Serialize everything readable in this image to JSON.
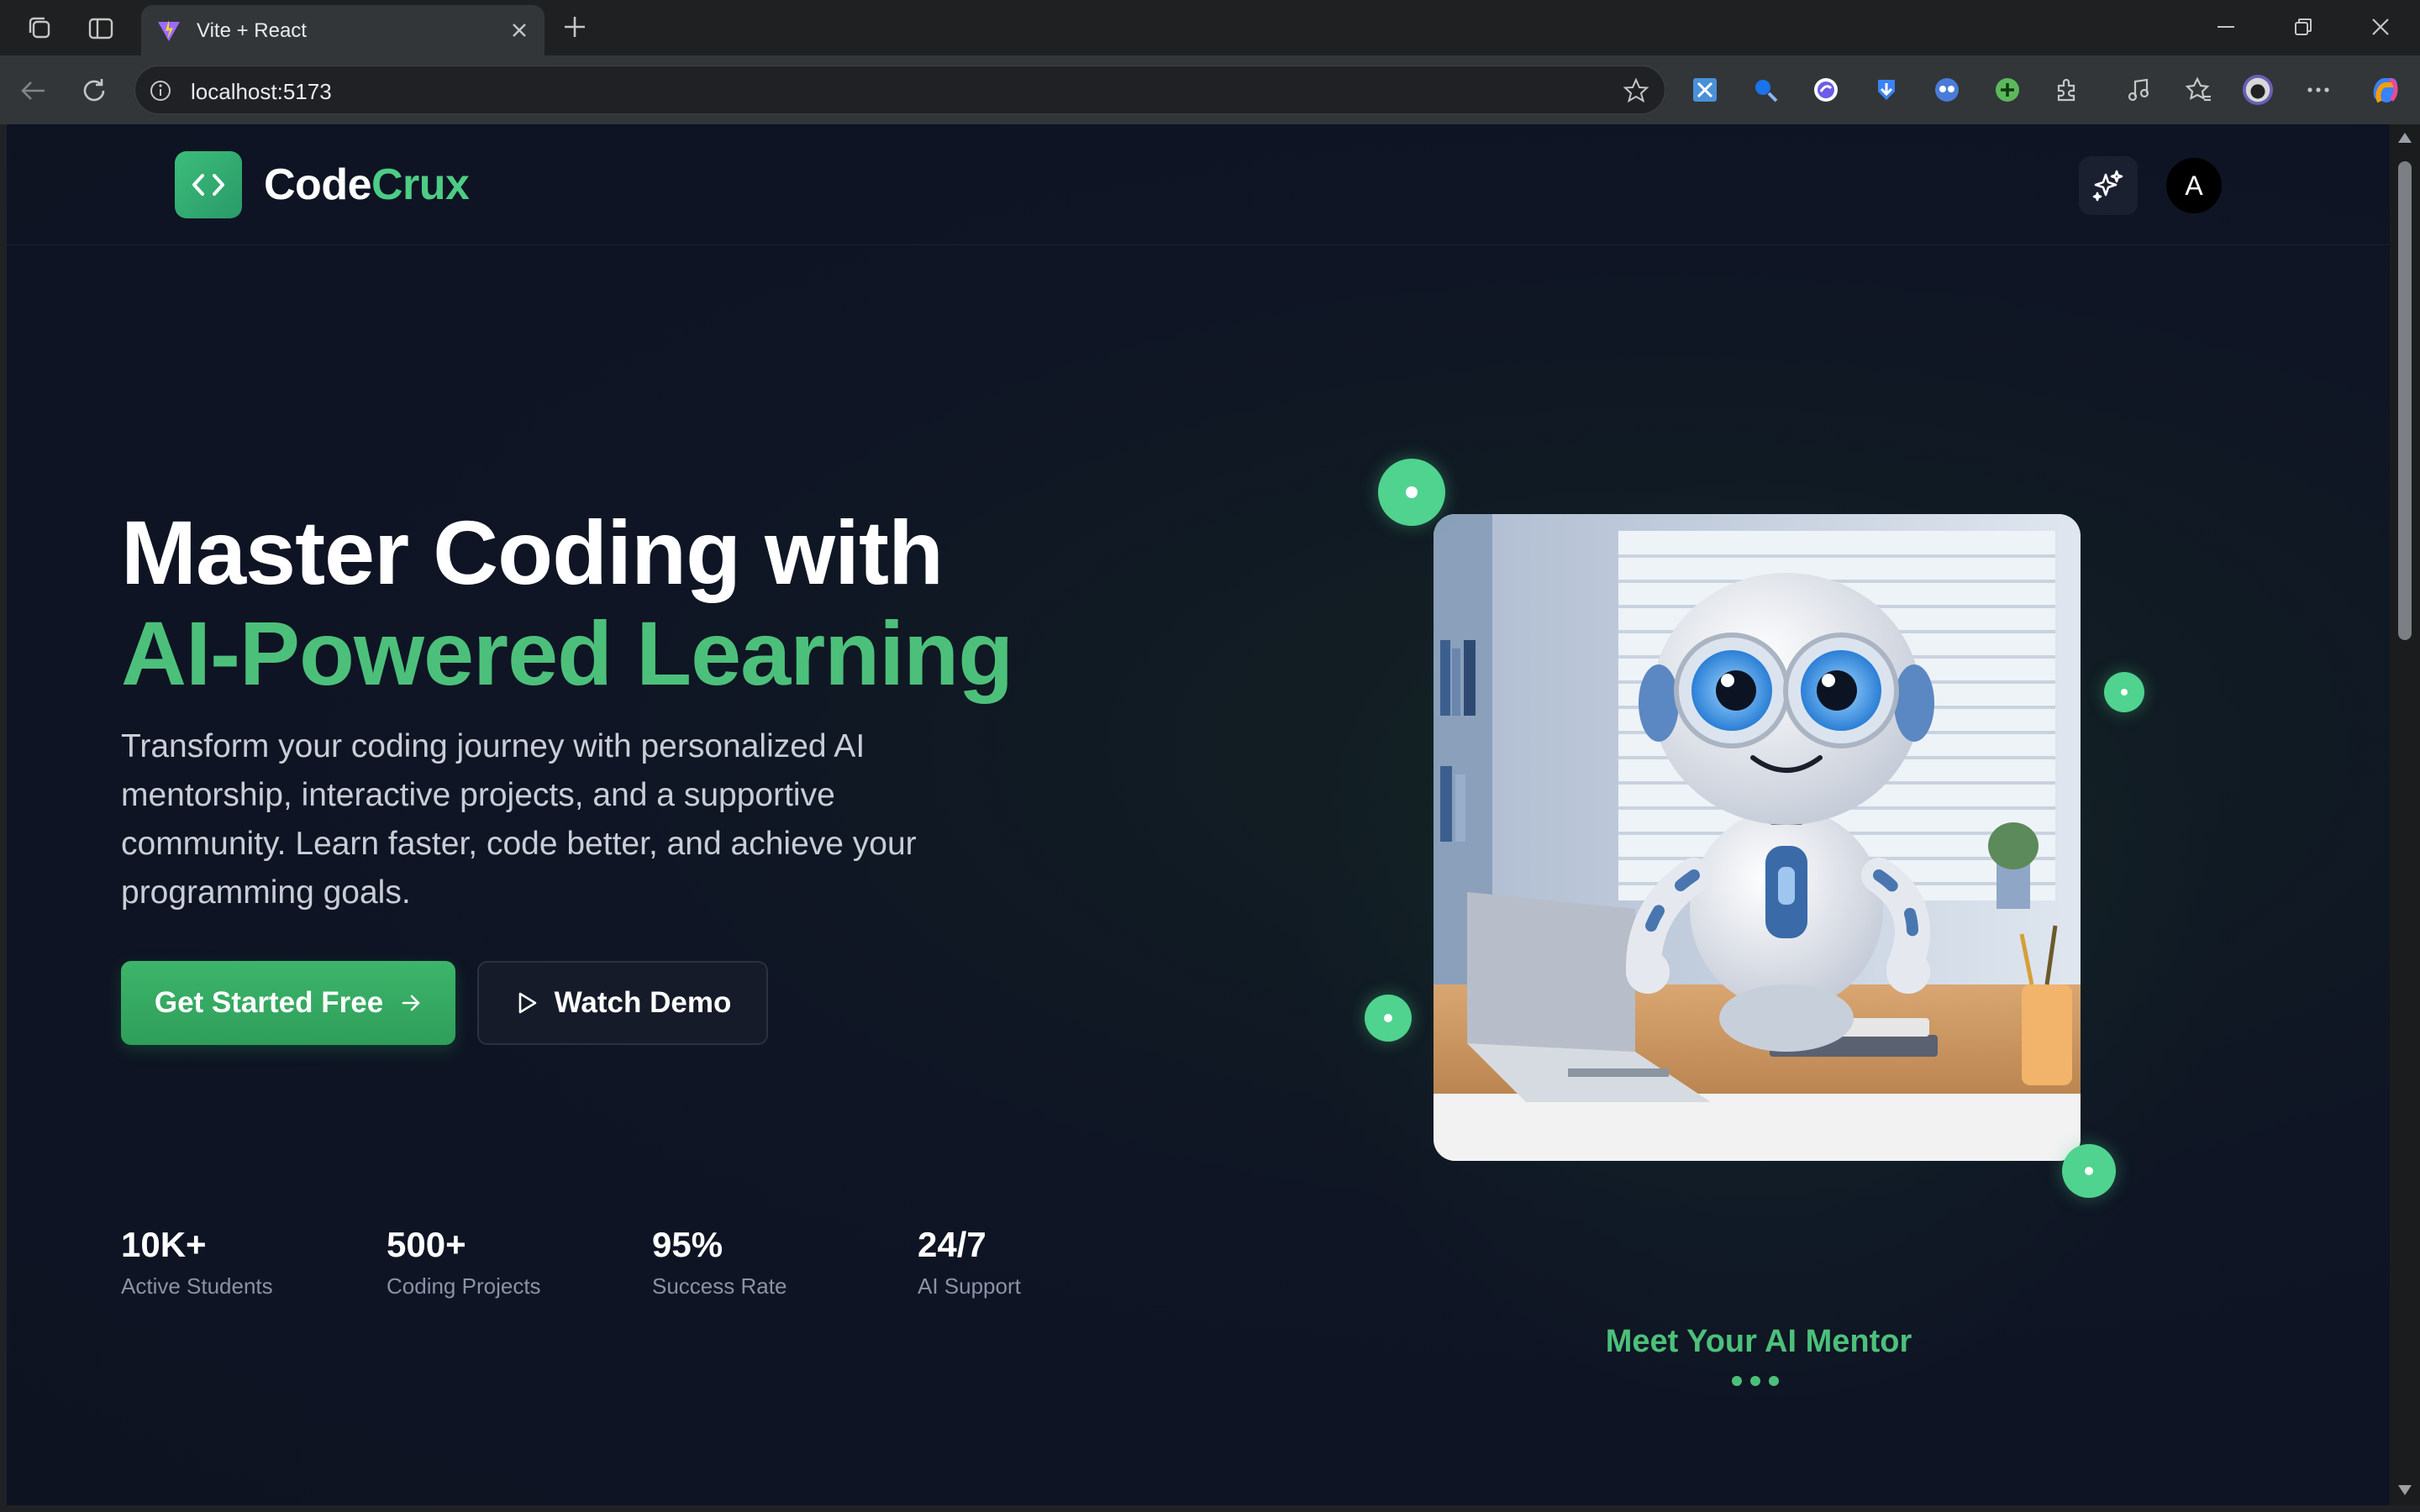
{
  "browser": {
    "tab_title": "Vite + React",
    "url": "localhost:5173"
  },
  "site": {
    "brand_part1": "Code",
    "brand_part2": "Crux",
    "avatar_letter": "A"
  },
  "hero": {
    "headline_line1": "Master Coding with",
    "headline_line2": "AI-Powered Learning",
    "description": "Transform your coding journey with personalized AI mentorship, interactive projects, and a supportive community. Learn faster, code better, and achieve your programming goals.",
    "primary_button": "Get Started Free",
    "secondary_button": "Watch Demo",
    "stats": [
      {
        "value": "10K+",
        "label": "Active Students"
      },
      {
        "value": "500+",
        "label": "Coding Projects"
      },
      {
        "value": "95%",
        "label": "Success Rate"
      },
      {
        "value": "24/7",
        "label": "AI Support"
      }
    ]
  },
  "mentor": {
    "title": "Meet Your AI Mentor"
  },
  "colors": {
    "accent": "#4cc07a",
    "background": "#0e1322",
    "primary_button": "#3cb56a"
  }
}
